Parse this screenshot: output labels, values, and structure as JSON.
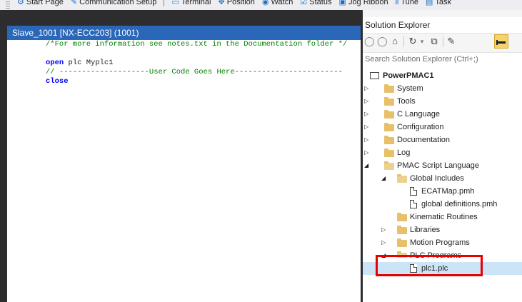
{
  "toolbar": {
    "items": [
      {
        "label": "Start Page",
        "icon": "gear-icon"
      },
      {
        "label": "Communication Setup",
        "icon": "pin-icon"
      },
      {
        "label": "Terminal",
        "icon": "terminal-icon"
      },
      {
        "label": "Position",
        "icon": "position-icon"
      },
      {
        "label": "Watch",
        "icon": "watch-icon"
      },
      {
        "label": "Status",
        "icon": "status-icon"
      },
      {
        "label": "Jog Ribbon",
        "icon": "jog-icon"
      },
      {
        "label": "Tune",
        "icon": "tune-icon"
      },
      {
        "label": "Task",
        "icon": "task-icon"
      }
    ]
  },
  "editor": {
    "tab_title": "Slave_1001 [NX-ECC203] (1001)",
    "lines": [
      {
        "kind": "comment",
        "text": "/*For more information see notes.txt in the Documentation folder */"
      },
      {
        "kind": "blank",
        "text": ""
      },
      {
        "kind": "open",
        "keyword": "open",
        "plain": " plc Myplc1"
      },
      {
        "kind": "comment",
        "text": "// --------------------User Code Goes Here------------------------"
      },
      {
        "kind": "keyword",
        "text": "close"
      }
    ]
  },
  "solution_explorer": {
    "title": "Solution Explorer",
    "search_placeholder": "Search Solution Explorer (Ctrl+;)",
    "project": "PowerPMAC1",
    "folders": [
      {
        "label": "System"
      },
      {
        "label": "Tools"
      },
      {
        "label": "C Language"
      },
      {
        "label": "Configuration"
      },
      {
        "label": "Documentation"
      },
      {
        "label": "Log"
      },
      {
        "label": "PMAC Script Language"
      }
    ],
    "script_children": {
      "global_includes": "Global Includes",
      "files": [
        "ECATMap.pmh",
        "global definitions.pmh"
      ],
      "kinematic": "Kinematic Routines",
      "libraries": "Libraries",
      "motion": "Motion Programs",
      "plc_programs": "PLC Programs",
      "selected_file": "plc1.plc"
    },
    "colors": {
      "selection": "#cce4f7",
      "highlight_box": "#e60000"
    }
  }
}
